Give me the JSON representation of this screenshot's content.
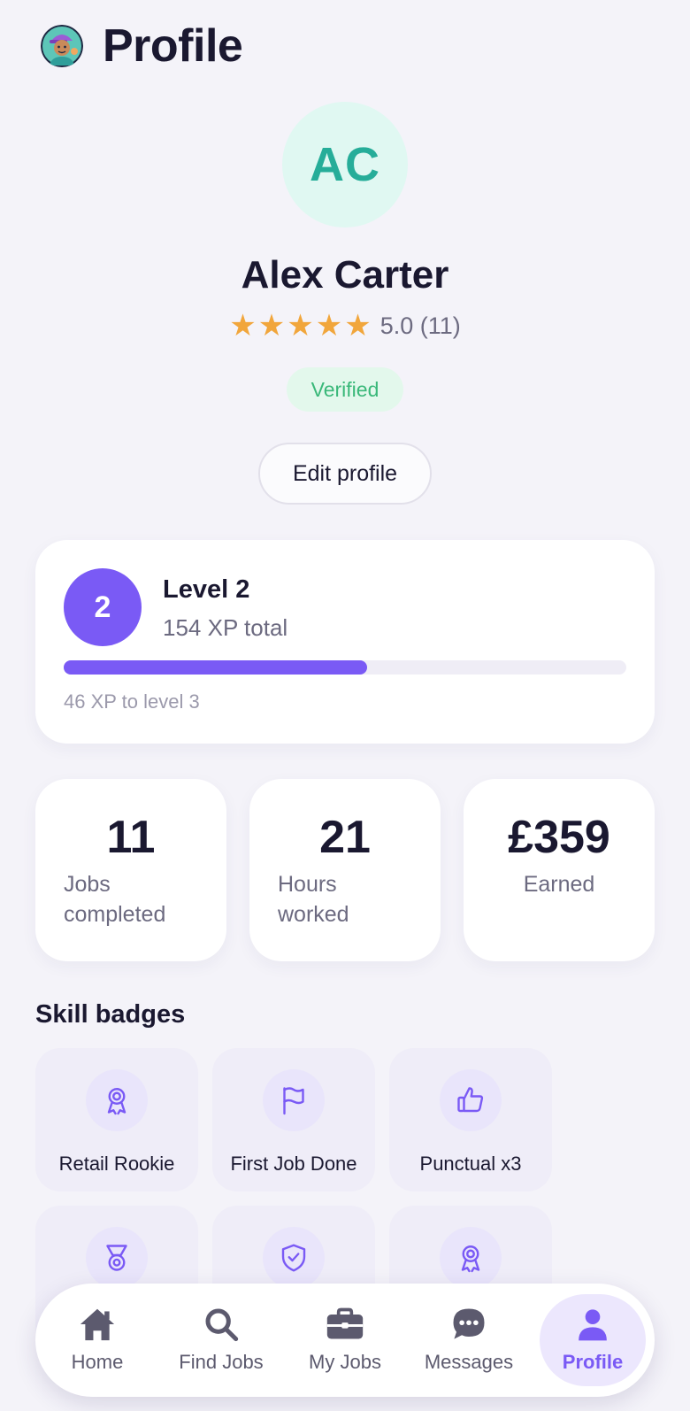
{
  "header": {
    "title": "Profile",
    "logo_icon": "mascot-avatar-icon"
  },
  "profile": {
    "initials": "AC",
    "name": "Alex Carter",
    "rating_value": "5.0 (11)",
    "stars": 5,
    "verified_label": "Verified",
    "edit_label": "Edit profile"
  },
  "level": {
    "number": "2",
    "title": "Level 2",
    "xp_total": "154 XP total",
    "progress_fraction": 0.54,
    "caption": "46 XP to level 3"
  },
  "stats": [
    {
      "value": "11",
      "label": "Jobs completed"
    },
    {
      "value": "21",
      "label": "Hours worked"
    },
    {
      "value": "£359",
      "label": "Earned"
    }
  ],
  "skills": {
    "title": "Skill badges",
    "badges": [
      {
        "label": "Retail Rookie",
        "icon": "award-ribbon-icon"
      },
      {
        "label": "First Job Done",
        "icon": "flag-icon"
      },
      {
        "label": "Punctual x3",
        "icon": "thumbs-up-icon"
      },
      {
        "label": "",
        "icon": "medal-icon"
      },
      {
        "label": "",
        "icon": "shield-check-icon"
      },
      {
        "label": "",
        "icon": "award-ribbon-icon"
      }
    ]
  },
  "tabbar": {
    "items": [
      {
        "label": "Home",
        "icon": "home-icon"
      },
      {
        "label": "Find Jobs",
        "icon": "search-icon"
      },
      {
        "label": "My Jobs",
        "icon": "briefcase-icon"
      },
      {
        "label": "Messages",
        "icon": "chat-bubble-icon"
      },
      {
        "label": "Profile",
        "icon": "user-icon"
      }
    ],
    "active": "Profile"
  },
  "colors": {
    "accent": "#7a5af5",
    "avatar_bg": "#e0f8f2",
    "avatar_text": "#26ad99",
    "star": "#f1a63c",
    "verified_bg": "#e3f8ec",
    "verified_text": "#3ab879",
    "background": "#f4f3f9"
  }
}
